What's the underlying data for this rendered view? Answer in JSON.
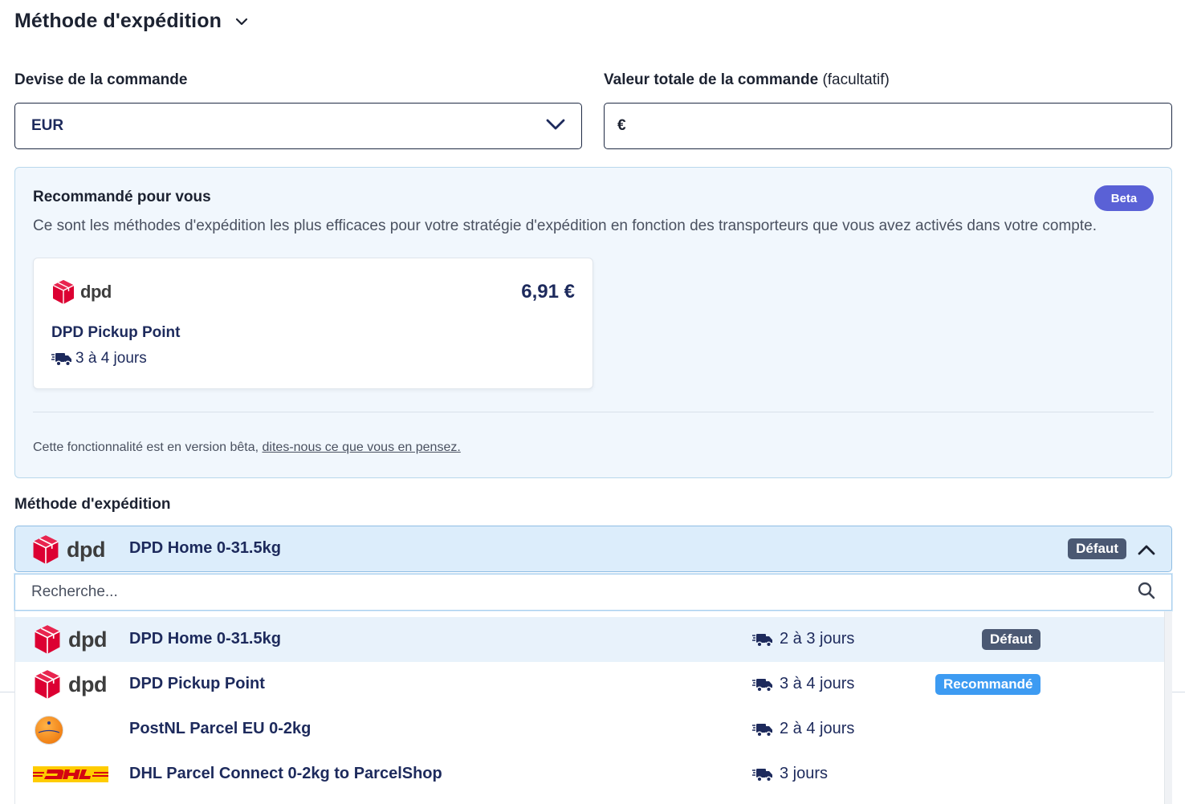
{
  "header": {
    "title": "Méthode d'expédition"
  },
  "currency": {
    "label": "Devise de la commande",
    "value": "EUR"
  },
  "total": {
    "label": "Valeur totale de la commande",
    "optional": "(facultatif)",
    "symbol": "€",
    "value": ""
  },
  "recommended": {
    "title": "Recommandé pour vous",
    "badge": "Beta",
    "description": "Ce sont les méthodes d'expédition les plus efficaces pour votre stratégie d'expédition en fonction des transporteurs que vous avez activés dans votre compte.",
    "card": {
      "carrier": "dpd",
      "price": "6,91 €",
      "name": "DPD Pickup Point",
      "days": "3 à 4 jours"
    },
    "footer_text": "Cette fonctionnalité est en version bêta, ",
    "footer_link": "dites-nous ce que vous en pensez."
  },
  "method": {
    "label": "Méthode d'expédition",
    "selected": {
      "carrier": "dpd",
      "name": "DPD Home 0-31.5kg",
      "badge": "Défaut"
    },
    "search_placeholder": "Recherche...",
    "options": [
      {
        "carrier": "dpd",
        "name": "DPD Home 0-31.5kg",
        "days": "2 à 3 jours",
        "badge": "Défaut"
      },
      {
        "carrier": "dpd",
        "name": "DPD Pickup Point",
        "days": "3 à 4 jours",
        "badge": "Recommandé"
      },
      {
        "carrier": "postnl",
        "name": "PostNL Parcel EU 0-2kg",
        "days": "2 à 4 jours",
        "badge": ""
      },
      {
        "carrier": "dhl",
        "name": "DHL Parcel Connect 0-2kg to ParcelShop",
        "days": "3 jours",
        "badge": ""
      }
    ]
  },
  "colors": {
    "dpd_red": "#dc0032",
    "text_navy": "#1d2a5c",
    "beta_purple": "#5a61d6",
    "reco_blue": "#3d9bf2",
    "default_slate": "#4b5973"
  },
  "icons": {
    "truck": "truck-fast-icon",
    "search": "search-icon",
    "chevron_down": "chevron-down-icon",
    "chevron_up": "chevron-up-icon"
  }
}
